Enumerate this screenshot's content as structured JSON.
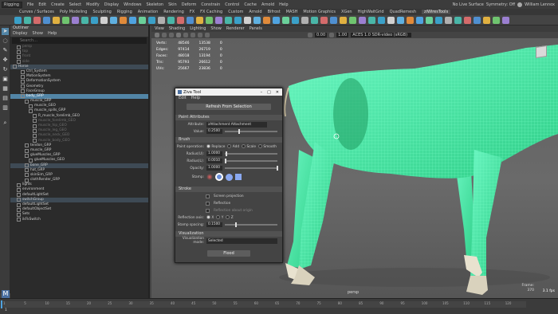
{
  "menubar": {
    "mode": "Rigging",
    "items": [
      "File",
      "Edit",
      "Create",
      "Select",
      "Modify",
      "Display",
      "Windows",
      "Skeleton",
      "Skin",
      "Deform",
      "Constrain",
      "Control",
      "Cache",
      "Arnold",
      "Help"
    ],
    "no_live_surface": "No Live Surface",
    "symmetry": "Symmetry: Off",
    "user": "William Lennox"
  },
  "shelf_tabs": [
    "Curves / Surfaces",
    "Poly Modeling",
    "Sculpting",
    "Rigging",
    "Animation",
    "Rendering",
    "FX",
    "FX Caching",
    "Custom",
    "Arnold",
    "Bifrost",
    "MASH",
    "Motion Graphics",
    "XGen",
    "HighWaitGrid",
    "QuadRemesh",
    "ziWiresTools"
  ],
  "shelf_tab_active": "ziWiresTools",
  "toolbox": [
    "select-icon",
    "lasso-icon",
    "paint-icon",
    "move-icon",
    "rotate-icon",
    "scale-icon"
  ],
  "outliner": {
    "title": "Outliner",
    "menu": [
      "Display",
      "Show",
      "Help"
    ],
    "search_placeholder": "Search...",
    "rows": [
      {
        "label": "persp",
        "indent": 1,
        "cls": "dim"
      },
      {
        "label": "top",
        "indent": 1,
        "cls": "dim"
      },
      {
        "label": "front",
        "indent": 1,
        "cls": "dim"
      },
      {
        "label": "side",
        "indent": 1,
        "cls": "dim"
      },
      {
        "label": "Horse",
        "indent": 0,
        "cls": "hl"
      },
      {
        "label": "Ctrl_System",
        "indent": 2,
        "cls": ""
      },
      {
        "label": "MotionSystem",
        "indent": 2,
        "cls": ""
      },
      {
        "label": "DeformationSystem",
        "indent": 2,
        "cls": ""
      },
      {
        "label": "Geometry",
        "indent": 2,
        "cls": ""
      },
      {
        "label": "FaceGroup",
        "indent": 2,
        "cls": ""
      },
      {
        "label": "body_GRP",
        "indent": 2,
        "cls": "sel"
      },
      {
        "label": "muscle_GRP",
        "indent": 3,
        "cls": ""
      },
      {
        "label": "muscle_GEO",
        "indent": 4,
        "cls": ""
      },
      {
        "label": "muscle_spills_GRP",
        "indent": 4,
        "cls": ""
      },
      {
        "label": "R_muscle_forelimb_GEO",
        "indent": 5,
        "cls": ""
      },
      {
        "label": "muscle_forelimb_GEO",
        "indent": 5,
        "cls": "dim"
      },
      {
        "label": "muscle_hip_GEO",
        "indent": 5,
        "cls": "dim"
      },
      {
        "label": "muscle_leg_GEO",
        "indent": 5,
        "cls": "dim"
      },
      {
        "label": "muscle_neck_GEO",
        "indent": 5,
        "cls": "dim"
      },
      {
        "label": "muscle_body_GEO",
        "indent": 5,
        "cls": "dim"
      },
      {
        "label": "tendon_GRP",
        "indent": 3,
        "cls": ""
      },
      {
        "label": "muscle_GRP",
        "indent": 3,
        "cls": ""
      },
      {
        "label": "glueMuscles_GRP",
        "indent": 3,
        "cls": ""
      },
      {
        "label": "glueMuscles_GEO",
        "indent": 4,
        "cls": ""
      },
      {
        "label": "bone_GRP",
        "indent": 3,
        "cls": "hl"
      },
      {
        "label": "hat_GRP",
        "indent": 3,
        "cls": ""
      },
      {
        "label": "skinSim_GRP",
        "indent": 3,
        "cls": ""
      },
      {
        "label": "clothRender_GRP",
        "indent": 3,
        "cls": ""
      },
      {
        "label": "lights",
        "indent": 1,
        "cls": ""
      },
      {
        "label": "environment",
        "indent": 1,
        "cls": ""
      },
      {
        "label": "defaultLightSet",
        "indent": 1,
        "cls": ""
      },
      {
        "label": "switchGroup",
        "indent": 1,
        "cls": "hl"
      },
      {
        "label": "defaultLightSet",
        "indent": 1,
        "cls": ""
      },
      {
        "label": "defaultObjectSet",
        "indent": 1,
        "cls": ""
      },
      {
        "label": "Sets",
        "indent": 1,
        "cls": ""
      },
      {
        "label": "ikFkSwitch",
        "indent": 1,
        "cls": ""
      }
    ]
  },
  "viewport": {
    "menu": [
      "View",
      "Shading",
      "Lighting",
      "Show",
      "Renderer",
      "Panels"
    ],
    "toolbar_values": [
      "0.00",
      "1.00"
    ],
    "color_space": "ACES 1.0 SDR-video (sRGB)",
    "hud": [
      [
        "Verts:",
        "48546",
        "13538",
        "0"
      ],
      [
        "Edges:",
        "97414",
        "26719",
        "0"
      ],
      [
        "Faces:",
        "48018",
        "13194",
        "0"
      ],
      [
        "Tris:",
        "95793",
        "26612",
        "0"
      ],
      [
        "UVs:",
        "25667",
        "23836",
        "0"
      ]
    ],
    "camera": "persp",
    "frames_label": "Frame:",
    "frames_value": "370",
    "fps": "3.1 fps"
  },
  "dialog": {
    "title": "Ziva Tool",
    "menu": [
      "Edit",
      "Help"
    ],
    "refresh_button": "Refresh From Selection",
    "paint_attributes": {
      "header": "Paint Attributes",
      "attribute_label": "Attribute:",
      "attribute_value": "zAttachment Attachment",
      "value_label": "Value:",
      "value": "0.2500"
    },
    "brush": {
      "header": "Brush",
      "operation_label": "Paint operation:",
      "operations": [
        "Replace",
        "Add",
        "Scale",
        "Smooth"
      ],
      "radius_u_label": "Radius(U):",
      "radius_u": "1.0000",
      "radius_l_label": "Radius(L):",
      "radius_l": "0.0010",
      "opacity_label": "Opacity:",
      "opacity": "1.0000",
      "stamp_label": "Stamp:"
    },
    "stroke": {
      "header": "Stroke",
      "screen_projection": "Screen projection",
      "reflection": "Reflection",
      "reflect_about_origin": "Reflection about origin",
      "reflection_axis_label": "Reflection axis:",
      "axes": [
        "X",
        "Y",
        "Z"
      ],
      "stamp_spacing_label": "Stamp spacing:",
      "stamp_spacing": "0.1500"
    },
    "visualization": {
      "header": "Visualization",
      "mode_label": "Visualization mode:",
      "mode_value": "Selected"
    },
    "flood_button": "Flood"
  },
  "timeline": {
    "current_frame": "1",
    "marks": [
      "1",
      "5",
      "10",
      "15",
      "20",
      "25",
      "30",
      "35",
      "40",
      "45",
      "50",
      "55",
      "60",
      "65",
      "70",
      "75",
      "80",
      "85",
      "90",
      "95",
      "100",
      "105",
      "110",
      "115",
      "120"
    ]
  },
  "colors": {
    "accent": "#5285a6",
    "horse": "#3fe4a0",
    "selection": "#5285a6"
  }
}
